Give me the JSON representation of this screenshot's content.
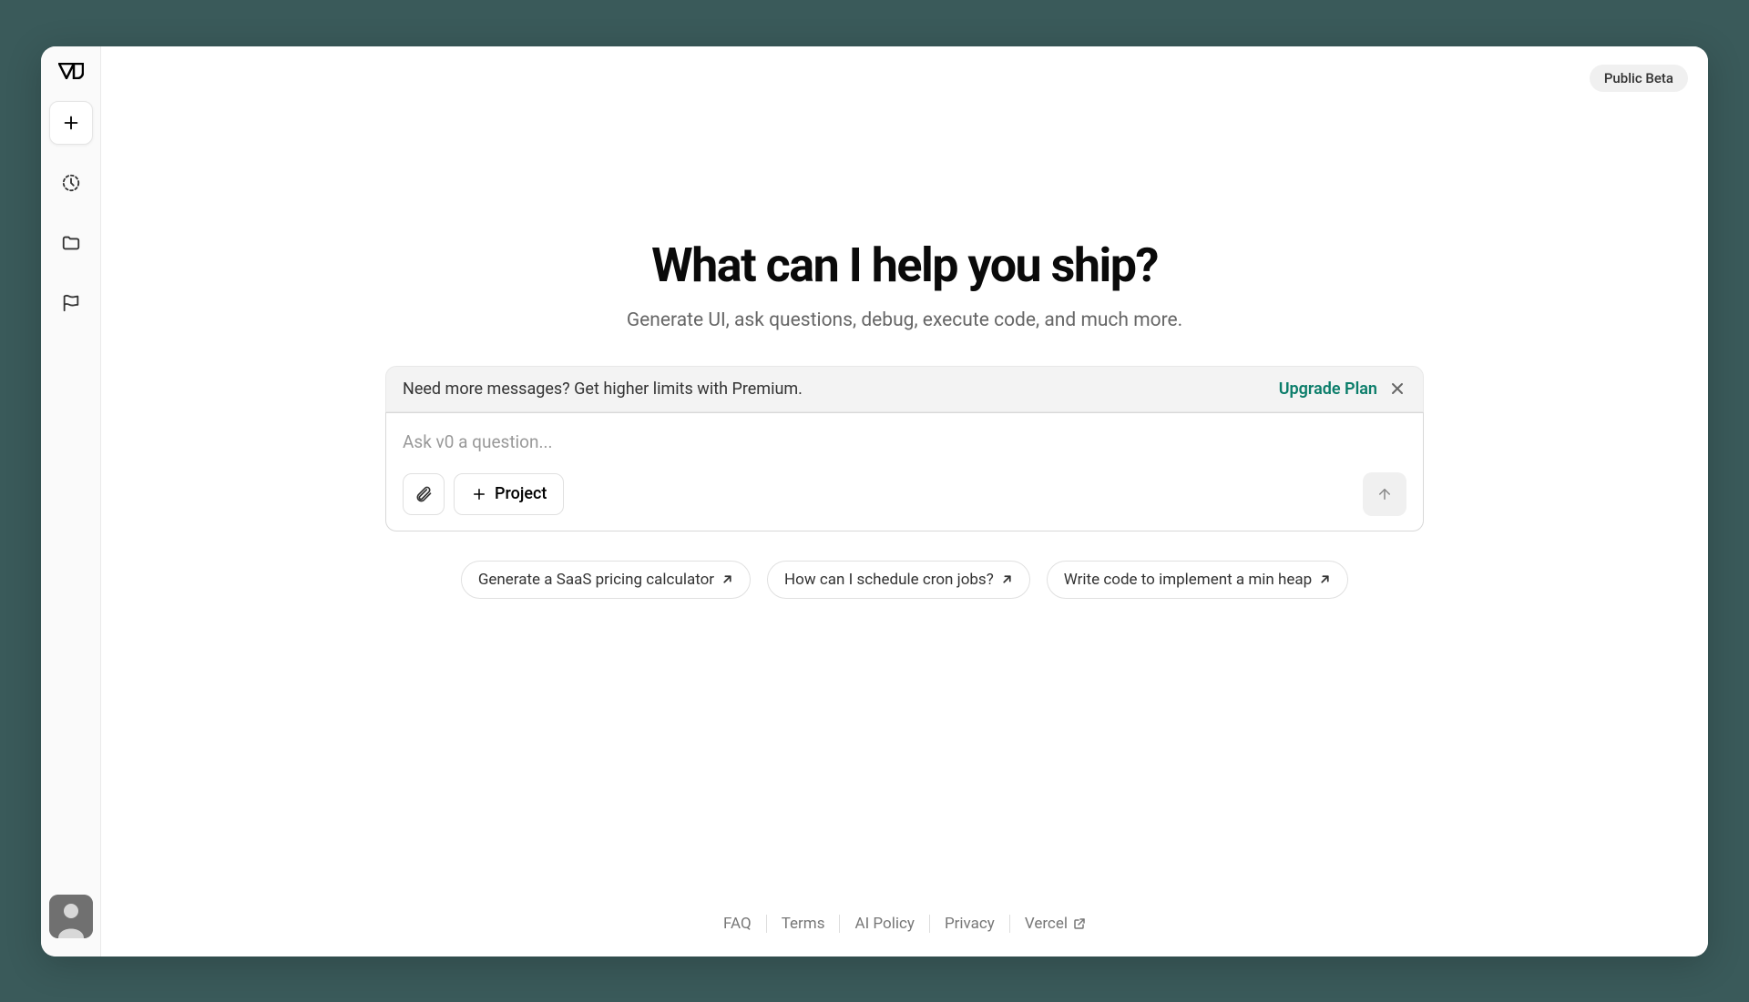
{
  "header": {
    "badge": "Public Beta"
  },
  "sidebar": {
    "logo": "v0"
  },
  "hero": {
    "heading": "What can I help you ship?",
    "subheading": "Generate UI, ask questions, debug, execute code, and much more."
  },
  "banner": {
    "text": "Need more messages? Get higher limits with Premium.",
    "cta": "Upgrade Plan"
  },
  "input": {
    "placeholder": "Ask v0 a question...",
    "project_label": "Project"
  },
  "suggestions": [
    "Generate a SaaS pricing calculator",
    "How can I schedule cron jobs?",
    "Write code to implement a min heap"
  ],
  "footer": {
    "links": [
      "FAQ",
      "Terms",
      "AI Policy",
      "Privacy",
      "Vercel"
    ]
  }
}
